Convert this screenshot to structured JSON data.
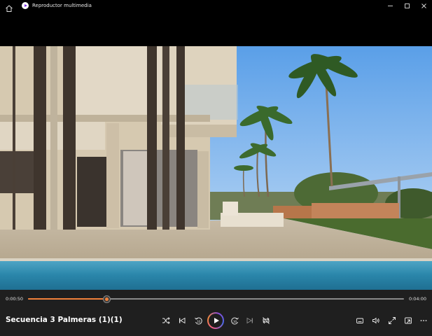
{
  "window": {
    "title": "Reproductor multimedia",
    "controls": [
      "minimize-icon",
      "maximize-icon",
      "close-icon"
    ]
  },
  "player": {
    "current_time": "0:00:50",
    "total_time": "0:04:00",
    "progress": 0.208,
    "title": "Secuencia 3 Palmeras (1)(1)",
    "accent": "#f1813b"
  },
  "controls": {
    "center": [
      "shuffle-icon",
      "previous-icon",
      "rewind-10-icon",
      "play-icon",
      "forward-30-icon",
      "next-icon",
      "repeat-icon"
    ],
    "right": [
      "subtitles-icon",
      "volume-icon",
      "fullscreen-icon",
      "miniplayer-icon",
      "more-icon"
    ]
  }
}
